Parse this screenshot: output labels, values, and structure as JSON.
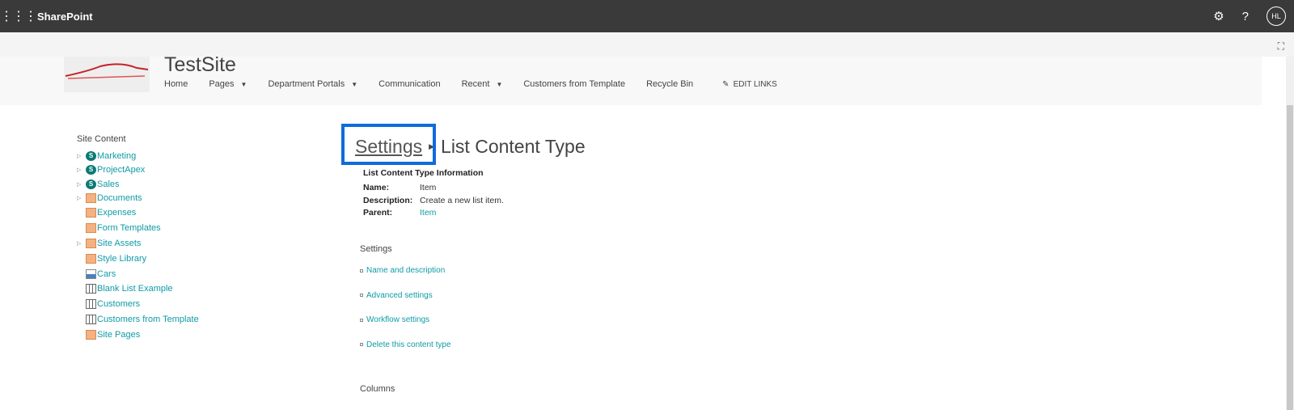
{
  "topbar": {
    "brand": "SharePoint",
    "settings_icon": "gear-icon",
    "help": "?",
    "avatar": "HL"
  },
  "site": {
    "title": "TestSite",
    "nav": [
      {
        "label": "Home",
        "dropdown": false
      },
      {
        "label": "Pages",
        "dropdown": true
      },
      {
        "label": "Department Portals",
        "dropdown": true
      },
      {
        "label": "Communication",
        "dropdown": false
      },
      {
        "label": "Recent",
        "dropdown": true
      },
      {
        "label": "Customers from Template",
        "dropdown": false
      },
      {
        "label": "Recycle Bin",
        "dropdown": false
      }
    ],
    "edit_links": "EDIT LINKS"
  },
  "sidebar": {
    "header": "Site Content",
    "items": [
      {
        "label": "Marketing",
        "icon": "site",
        "expand": true
      },
      {
        "label": "ProjectApex",
        "icon": "site",
        "expand": true
      },
      {
        "label": "Sales",
        "icon": "site",
        "expand": true
      },
      {
        "label": "Documents",
        "icon": "lib",
        "expand": true
      },
      {
        "label": "Expenses",
        "icon": "lib",
        "expand": false
      },
      {
        "label": "Form Templates",
        "icon": "lib",
        "expand": false
      },
      {
        "label": "Site Assets",
        "icon": "lib",
        "expand": true
      },
      {
        "label": "Style Library",
        "icon": "lib",
        "expand": false
      },
      {
        "label": "Cars",
        "icon": "pic",
        "expand": false
      },
      {
        "label": "Blank List Example",
        "icon": "list",
        "expand": false
      },
      {
        "label": "Customers",
        "icon": "list",
        "expand": false
      },
      {
        "label": "Customers from Template",
        "icon": "list",
        "expand": false
      },
      {
        "label": "Site Pages",
        "icon": "lib",
        "expand": false
      }
    ]
  },
  "breadcrumb": {
    "parent": "Settings",
    "current": "List Content Type"
  },
  "info": {
    "title": "List Content Type Information",
    "name_label": "Name:",
    "name": "Item",
    "desc_label": "Description:",
    "desc": "Create a new list item.",
    "parent_label": "Parent:",
    "parent": "Item"
  },
  "settings": {
    "header": "Settings",
    "links": [
      "Name and description",
      "Advanced settings",
      "Workflow settings",
      "Delete this content type"
    ]
  },
  "columns": {
    "header": "Columns"
  }
}
